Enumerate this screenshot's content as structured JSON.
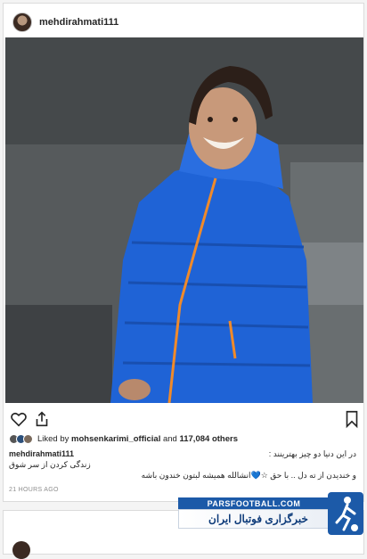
{
  "post": {
    "username": "mehdirahmati111",
    "likes": {
      "prefix": "Liked by",
      "user": "mohsenkarimi_official",
      "and": "and",
      "count": "117,084 others"
    },
    "caption": {
      "username": "mehdirahmati111",
      "line1": "در این دنیا دو چیز بهترینند :",
      "line2": "زندگی کردن از سر شوق",
      "line3": "و خندیدن از ته دل .. با حق ☆💙انشالله همیشه لبتون خندون باشه"
    },
    "timestamp": "21 HOURS AGO"
  },
  "watermark": {
    "domain": "PARSFOOTBALL.COM",
    "title": "خبرگزاری فوتبال ایران"
  },
  "colors": {
    "jacket": "#1f63d6",
    "zipper": "#f08a2a",
    "brand_blue": "#1c5aa8"
  },
  "icons": [
    "heart-icon",
    "share-icon",
    "bookmark-icon"
  ]
}
